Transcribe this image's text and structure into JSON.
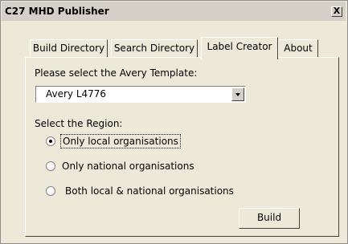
{
  "window": {
    "title": "C27 MHD Publisher",
    "close_label": "X"
  },
  "tabs": [
    {
      "label": "Build Directory",
      "active": false
    },
    {
      "label": "Search Directory",
      "active": false
    },
    {
      "label": "Label Creator",
      "active": true
    },
    {
      "label": "About",
      "active": false
    }
  ],
  "label_creator": {
    "template_prompt": "Please select the Avery Template:",
    "template_value": "Avery L4776",
    "region_prompt": "Select the Region:",
    "regions": [
      {
        "label": "Only local organisations",
        "selected": true
      },
      {
        "label": "Only national organisations",
        "selected": false
      },
      {
        "label": "Both local & national organisations",
        "selected": false
      }
    ],
    "build_label": "Build"
  }
}
